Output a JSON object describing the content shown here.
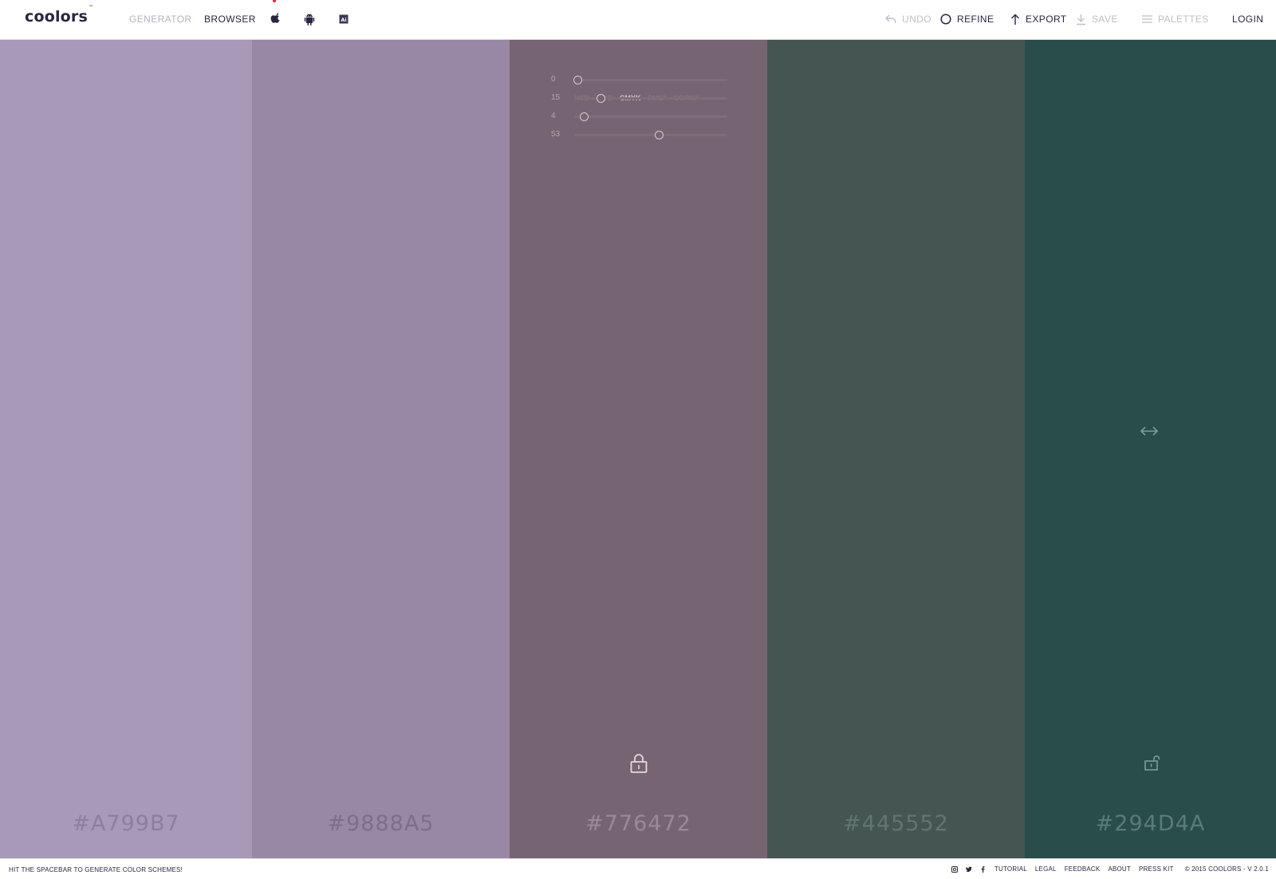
{
  "app": {
    "logo": "coolors",
    "logo_badge": "™"
  },
  "nav": {
    "generator": "GENERATOR",
    "browser": "BROWSER"
  },
  "actions": {
    "undo": "UNDO",
    "refine": "REFINE",
    "export": "EXPORT",
    "save": "SAVE",
    "palettes": "PALETTES",
    "login": "LOGIN"
  },
  "colors": {
    "accent": "#2a2540",
    "dim": "#b6b3be",
    "red_mark": "#e6263c"
  },
  "palette": [
    {
      "hex": "#A799B7",
      "bg": "#a799b7",
      "text": "#8c7e9c"
    },
    {
      "hex": "#9888A5",
      "bg": "#9888a5",
      "text": "#7d6e8b"
    },
    {
      "hex": "#776472",
      "bg": "#776472",
      "text": "#9a8997",
      "locked": true
    },
    {
      "hex": "#445552",
      "bg": "#445552",
      "text": "#637572"
    },
    {
      "hex": "#294D4A",
      "bg": "#294d4a",
      "text": "#5a7c79",
      "lock_open": true
    }
  ],
  "color_panel": {
    "modes": [
      "HSB",
      "RGB",
      "CMYK",
      "PMS*",
      "COPIC*"
    ],
    "active_mode": "CMYK",
    "sliders": [
      {
        "value": "0",
        "percent": 0
      },
      {
        "value": "15",
        "percent": 15
      },
      {
        "value": "4",
        "percent": 4
      },
      {
        "value": "53",
        "percent": 53
      }
    ]
  },
  "footer": {
    "tip": "HIT THE SPACEBAR TO GENERATE COLOR SCHEMES!",
    "links": [
      "TUTORIAL",
      "LEGAL",
      "FEEDBACK",
      "ABOUT",
      "PRESS KIT"
    ],
    "copyright": "© 2015 COOLORS - V 2.0.1"
  }
}
